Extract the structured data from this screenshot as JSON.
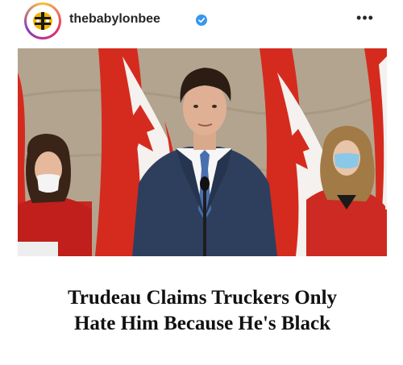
{
  "post": {
    "username": "thebabylonbee",
    "verified": true,
    "avatar_icon": "babylon-bee-logo",
    "more_icon": "more-horizontal-icon",
    "more_glyph": "•••"
  },
  "article": {
    "headline_line1": "Trudeau Claims Truckers Only",
    "headline_line2": "Hate Him Because He's Black"
  },
  "colors": {
    "verified_blue": "#3897f0",
    "flag_red": "#d52b1e"
  }
}
